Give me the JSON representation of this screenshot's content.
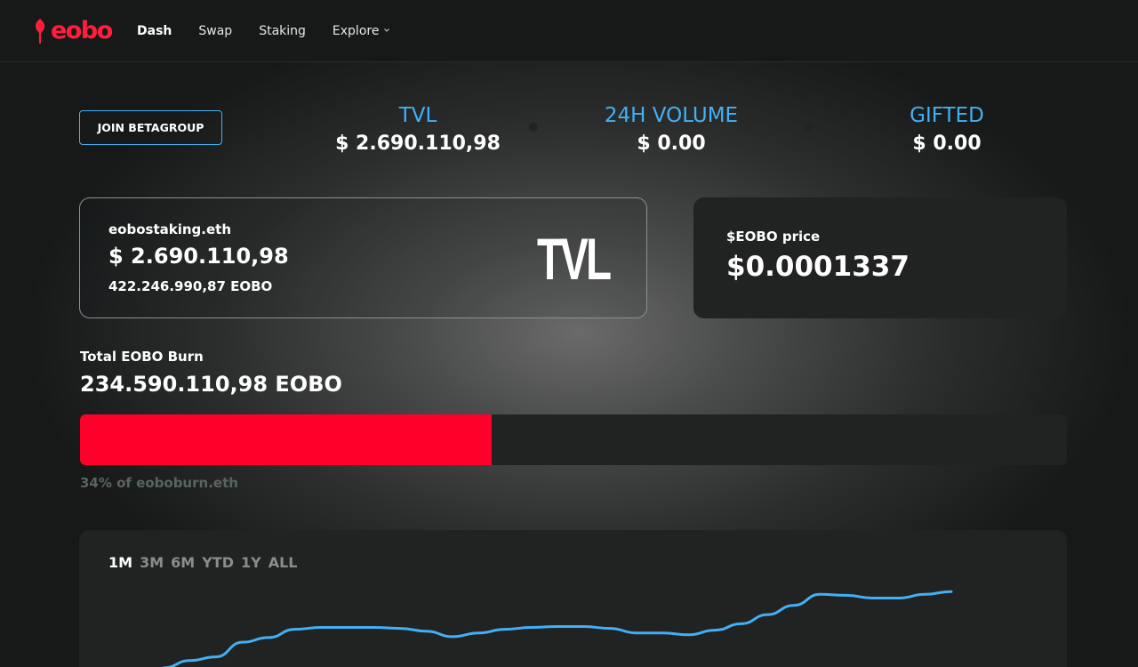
{
  "brand": {
    "name": "eobo",
    "accent": "#ff1e3c"
  },
  "nav": {
    "items": [
      {
        "label": "Dash",
        "active": true
      },
      {
        "label": "Swap"
      },
      {
        "label": "Staking"
      },
      {
        "label": "Explore",
        "has_dropdown": true,
        "icon": "chevron-down-icon"
      }
    ]
  },
  "header": {
    "join_label": "JOIN BETAGROUP"
  },
  "stats": [
    {
      "label": "TVL",
      "value": "$ 2.690.110,98"
    },
    {
      "label": "24H VOLUME",
      "value": "$ 0.00"
    },
    {
      "label": "GIFTED",
      "value": "$ 0.00"
    }
  ],
  "staking_card": {
    "name": "eobostaking.eth",
    "usd_value": "$ 2.690.110,98",
    "token_value": "422.246.990,87 EOBO",
    "big_label": "TVL"
  },
  "price_card": {
    "label": "$EOBO price",
    "value": "$0.0001337"
  },
  "burn": {
    "label": "Total EOBO Burn",
    "value": "234.590.110,98 EOBO",
    "progress": 0.417,
    "note": "34% of eoboburn.eth",
    "color": "#ff002b"
  },
  "chart": {
    "ranges": [
      "1M",
      "3M",
      "6M",
      "YTD",
      "1Y",
      "ALL"
    ],
    "active_range": "1M",
    "line_color": "#42b0f5"
  },
  "chart_data": {
    "type": "line",
    "x": [
      0,
      1,
      2,
      3,
      4,
      5,
      6,
      7,
      8,
      9,
      10,
      11,
      12,
      13,
      14,
      15,
      16,
      17,
      18,
      19,
      20,
      21,
      22,
      23,
      24,
      25,
      26,
      27,
      28,
      29,
      30
    ],
    "series": [
      {
        "values": [
          0,
          8,
          12,
          28,
          33,
          42,
          44,
          44,
          44,
          43,
          40,
          34,
          38,
          42,
          44,
          45,
          45,
          43,
          38,
          38,
          36,
          41,
          48,
          58,
          68,
          80,
          79,
          76,
          76,
          80,
          83
        ]
      }
    ],
    "ylim": [
      0,
      90
    ],
    "grid": false
  }
}
